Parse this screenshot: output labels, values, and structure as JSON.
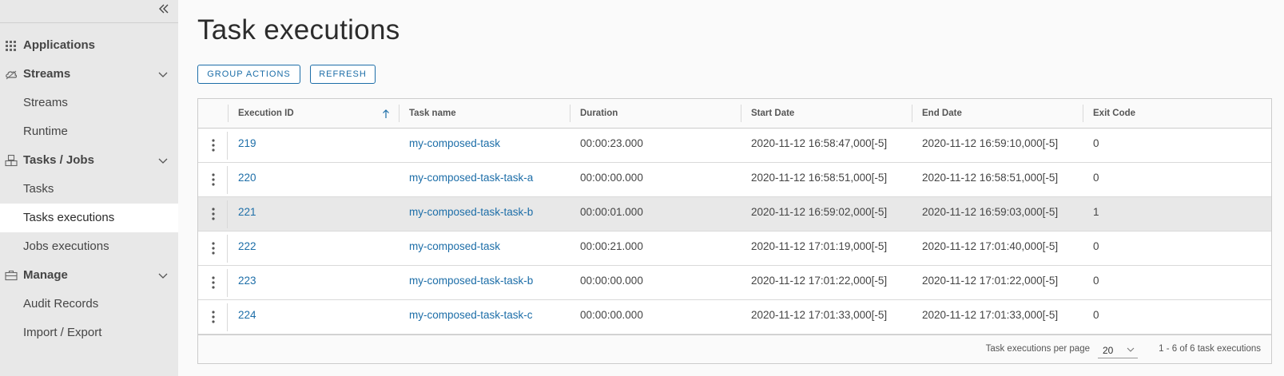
{
  "sidebar": {
    "groups": {
      "applications": "Applications",
      "streams": "Streams",
      "tasks_jobs": "Tasks / Jobs",
      "manage": "Manage"
    },
    "items": {
      "streams": "Streams",
      "runtime": "Runtime",
      "tasks": "Tasks",
      "tasks_executions": "Tasks executions",
      "jobs_executions": "Jobs executions",
      "audit_records": "Audit Records",
      "import_export": "Import / Export"
    },
    "active_item": "Tasks executions"
  },
  "main": {
    "title": "Task executions",
    "buttons": {
      "group_actions": "GROUP ACTIONS",
      "refresh": "REFRESH"
    }
  },
  "table": {
    "columns": [
      "Execution ID",
      "Task name",
      "Duration",
      "Start Date",
      "End Date",
      "Exit Code"
    ],
    "sort_column": "Execution ID",
    "sort_direction": "ascending",
    "rows": [
      [
        "219",
        "my-composed-task",
        "00:00:23.000",
        "2020-11-12 16:58:47,000[-5]",
        "2020-11-12 16:59:10,000[-5]",
        "0"
      ],
      [
        "220",
        "my-composed-task-task-a",
        "00:00:00.000",
        "2020-11-12 16:58:51,000[-5]",
        "2020-11-12 16:58:51,000[-5]",
        "0"
      ],
      [
        "221",
        "my-composed-task-task-b",
        "00:00:01.000",
        "2020-11-12 16:59:02,000[-5]",
        "2020-11-12 16:59:03,000[-5]",
        "1"
      ],
      [
        "222",
        "my-composed-task",
        "00:00:21.000",
        "2020-11-12 17:01:19,000[-5]",
        "2020-11-12 17:01:40,000[-5]",
        "0"
      ],
      [
        "223",
        "my-composed-task-task-b",
        "00:00:00.000",
        "2020-11-12 17:01:22,000[-5]",
        "2020-11-12 17:01:22,000[-5]",
        "0"
      ],
      [
        "224",
        "my-composed-task-task-c",
        "00:00:00.000",
        "2020-11-12 17:01:33,000[-5]",
        "2020-11-12 17:01:33,000[-5]",
        "0"
      ]
    ],
    "selected_row": "221"
  },
  "pagination": {
    "per_page_label": "Task executions per page",
    "per_page_value": "20",
    "range_text": "1 - 6 of 6 task executions"
  },
  "colors": {
    "accent": "#1d6ea8",
    "sidebar_bg": "#e8e8e8",
    "selected_row_bg": "#e8e8e8"
  },
  "icons": {
    "collapse": "double-chevron-left-icon",
    "applications": "grid-icon",
    "streams": "cloud-icon",
    "tasks_jobs": "cubes-icon",
    "manage": "briefcase-icon",
    "sort": "arrow-up-icon",
    "row_actions": "kebab-icon"
  }
}
